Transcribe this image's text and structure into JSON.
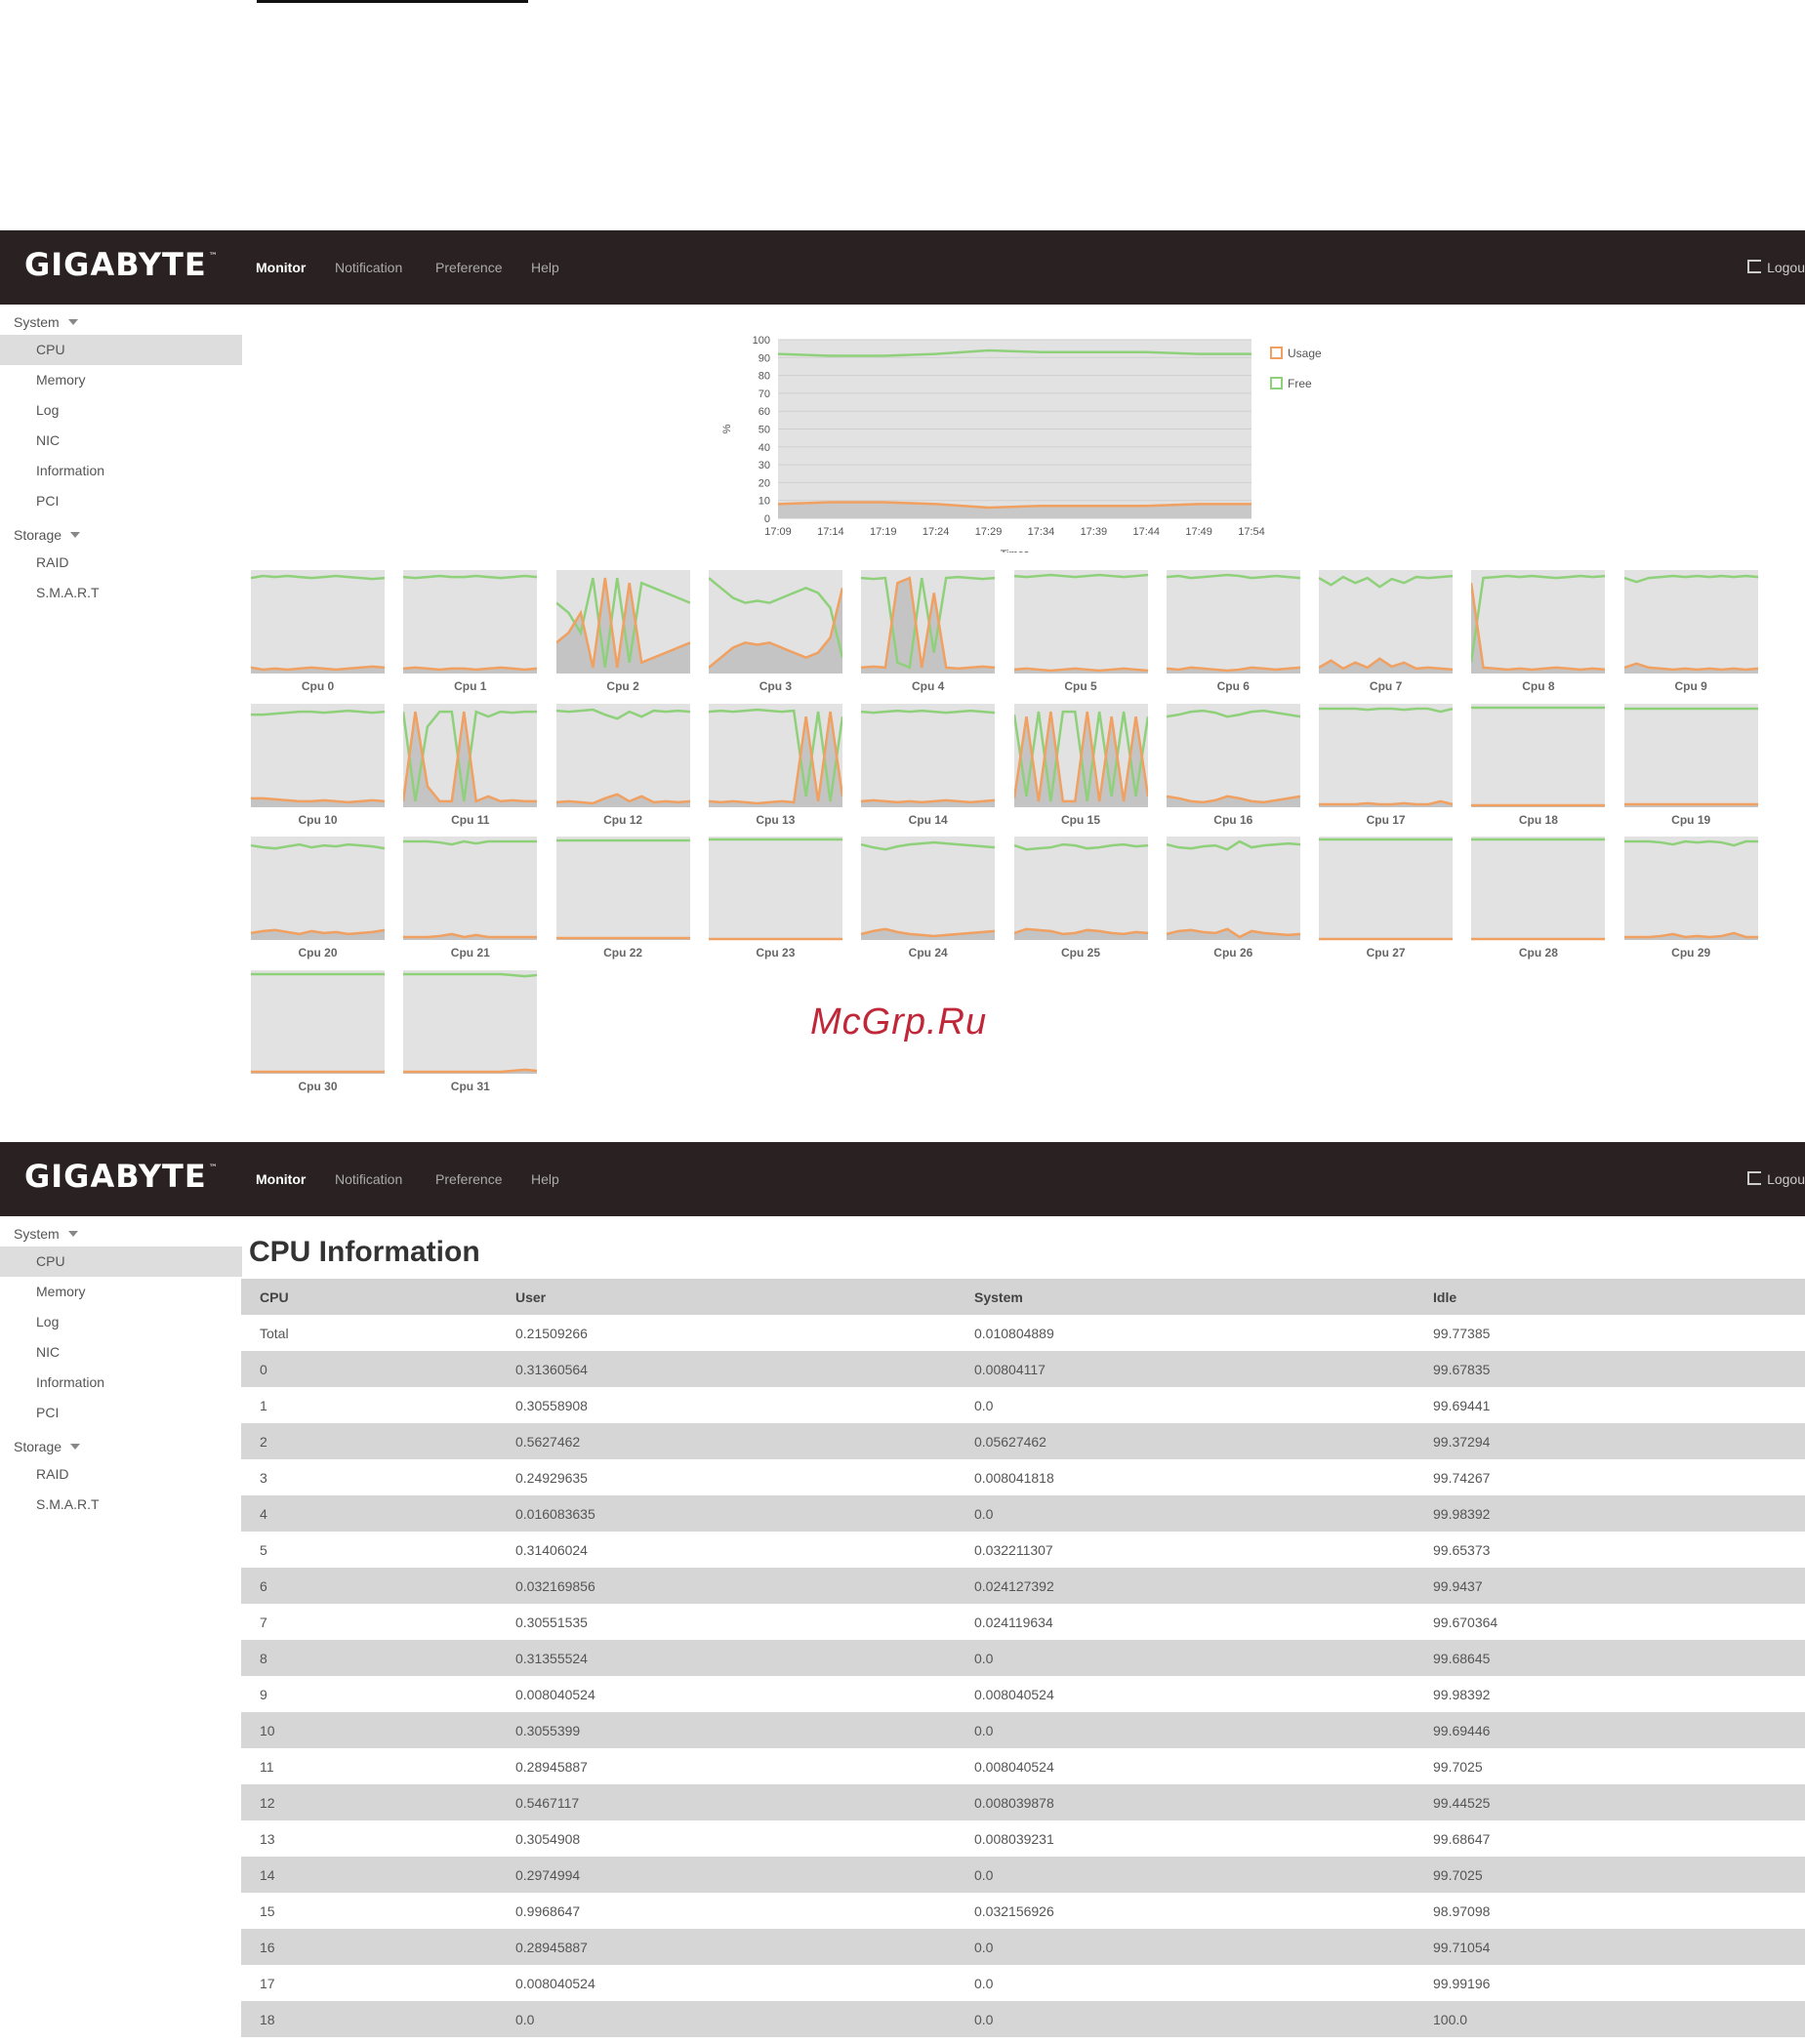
{
  "app": {
    "brand": "GIGABYTE",
    "brand_mark": "™",
    "nav": [
      "Monitor",
      "Notification",
      "Preference",
      "Help"
    ],
    "active_nav": "Monitor",
    "logout_label": "Logou"
  },
  "sidebar": {
    "groups": [
      {
        "label": "System",
        "items": [
          "CPU",
          "Memory",
          "Log",
          "NIC",
          "Information",
          "PCI"
        ]
      },
      {
        "label": "Storage",
        "items": [
          "RAID",
          "S.M.A.R.T"
        ]
      }
    ],
    "active_item": "CPU"
  },
  "watermark": "McGrp.Ru",
  "colors": {
    "usage": "#f0a060",
    "free": "#8fd07a",
    "fill": "#e2e2e2",
    "topbar": "#2a2222"
  },
  "chart_data": [
    {
      "type": "line",
      "title": "",
      "xlabel": "Times",
      "ylabel": "%",
      "ylim": [
        0,
        100
      ],
      "yticks": [
        0,
        10,
        20,
        30,
        40,
        50,
        60,
        70,
        80,
        90,
        100
      ],
      "x": [
        "17:09",
        "17:14",
        "17:19",
        "17:24",
        "17:29",
        "17:34",
        "17:39",
        "17:44",
        "17:49",
        "17:54"
      ],
      "legend_position": "right",
      "series": [
        {
          "name": "Usage",
          "values": [
            8,
            9,
            9,
            8,
            6,
            7,
            7,
            7,
            8,
            8
          ]
        },
        {
          "name": "Free",
          "values": [
            92,
            91,
            91,
            92,
            94,
            93,
            93,
            93,
            92,
            92
          ]
        }
      ]
    },
    {
      "type": "area",
      "ylim": [
        0,
        100
      ],
      "cpus": [
        {
          "label": "Cpu 0",
          "usage": [
            5,
            3,
            4,
            3,
            4,
            5,
            4,
            3,
            4,
            5,
            6,
            5
          ]
        },
        {
          "label": "Cpu 1",
          "usage": [
            4,
            5,
            4,
            3,
            4,
            4,
            3,
            4,
            5,
            4,
            3,
            4
          ]
        },
        {
          "label": "Cpu 2",
          "usage": [
            30,
            40,
            60,
            5,
            95,
            5,
            90,
            10,
            15,
            20,
            25,
            30
          ]
        },
        {
          "label": "Cpu 3",
          "usage": [
            5,
            15,
            25,
            30,
            28,
            30,
            25,
            20,
            15,
            20,
            35,
            85
          ]
        },
        {
          "label": "Cpu 4",
          "usage": [
            5,
            6,
            5,
            90,
            95,
            5,
            80,
            5,
            4,
            5,
            6,
            5
          ]
        },
        {
          "label": "Cpu 5",
          "usage": [
            3,
            4,
            3,
            2,
            3,
            4,
            3,
            2,
            3,
            4,
            3,
            2
          ]
        },
        {
          "label": "Cpu 6",
          "usage": [
            4,
            3,
            5,
            4,
            3,
            2,
            3,
            5,
            4,
            3,
            4,
            5
          ]
        },
        {
          "label": "Cpu 7",
          "usage": [
            5,
            12,
            4,
            10,
            5,
            14,
            6,
            10,
            4,
            5,
            4,
            3
          ]
        },
        {
          "label": "Cpu 8",
          "usage": [
            90,
            5,
            4,
            3,
            4,
            3,
            4,
            5,
            4,
            3,
            4,
            3
          ]
        },
        {
          "label": "Cpu 9",
          "usage": [
            5,
            9,
            5,
            4,
            3,
            4,
            3,
            4,
            3,
            4,
            3,
            4
          ]
        },
        {
          "label": "Cpu 10",
          "usage": [
            8,
            8,
            7,
            6,
            5,
            5,
            6,
            5,
            4,
            5,
            6,
            5
          ]
        },
        {
          "label": "Cpu 11",
          "usage": [
            5,
            95,
            20,
            5,
            5,
            95,
            5,
            10,
            5,
            6,
            5,
            5
          ]
        },
        {
          "label": "Cpu 12",
          "usage": [
            4,
            5,
            4,
            3,
            8,
            12,
            5,
            10,
            4,
            5,
            4,
            5
          ]
        },
        {
          "label": "Cpu 13",
          "usage": [
            5,
            4,
            5,
            4,
            3,
            4,
            5,
            4,
            90,
            5,
            95,
            10
          ]
        },
        {
          "label": "Cpu 14",
          "usage": [
            5,
            6,
            5,
            4,
            5,
            4,
            5,
            6,
            5,
            4,
            5,
            6
          ]
        },
        {
          "label": "Cpu 15",
          "usage": [
            8,
            90,
            5,
            95,
            5,
            5,
            95,
            5,
            90,
            5,
            90,
            10
          ]
        },
        {
          "label": "Cpu 16",
          "usage": [
            10,
            8,
            5,
            4,
            6,
            10,
            8,
            5,
            4,
            6,
            8,
            10
          ]
        },
        {
          "label": "Cpu 17",
          "usage": [
            2,
            2,
            2,
            2,
            3,
            2,
            2,
            3,
            2,
            2,
            5,
            2
          ]
        },
        {
          "label": "Cpu 18",
          "usage": [
            1,
            1,
            1,
            1,
            1,
            1,
            1,
            1,
            1,
            1,
            1,
            1
          ]
        },
        {
          "label": "Cpu 19",
          "usage": [
            2,
            2,
            2,
            2,
            2,
            2,
            2,
            2,
            2,
            2,
            2,
            2
          ]
        },
        {
          "label": "Cpu 20",
          "usage": [
            6,
            8,
            9,
            7,
            5,
            8,
            6,
            7,
            5,
            6,
            7,
            9
          ]
        },
        {
          "label": "Cpu 21",
          "usage": [
            2,
            2,
            2,
            3,
            5,
            2,
            4,
            2,
            2,
            2,
            2,
            2
          ]
        },
        {
          "label": "Cpu 22",
          "usage": [
            1,
            1,
            1,
            1,
            1,
            1,
            1,
            1,
            1,
            1,
            1,
            1
          ]
        },
        {
          "label": "Cpu 23",
          "usage": [
            0,
            0,
            0,
            0,
            0,
            0,
            0,
            0,
            0,
            0,
            0,
            0
          ]
        },
        {
          "label": "Cpu 24",
          "usage": [
            5,
            8,
            10,
            7,
            5,
            4,
            3,
            4,
            5,
            6,
            7,
            8
          ]
        },
        {
          "label": "Cpu 25",
          "usage": [
            6,
            10,
            9,
            8,
            5,
            6,
            9,
            8,
            6,
            5,
            7,
            6
          ]
        },
        {
          "label": "Cpu 26",
          "usage": [
            5,
            8,
            9,
            7,
            6,
            10,
            2,
            8,
            6,
            5,
            4,
            5
          ]
        },
        {
          "label": "Cpu 27",
          "usage": [
            0,
            0,
            0,
            0,
            0,
            0,
            0,
            0,
            0,
            0,
            0,
            0
          ]
        },
        {
          "label": "Cpu 28",
          "usage": [
            0,
            0,
            0,
            0,
            0,
            0,
            0,
            0,
            0,
            0,
            0,
            0
          ]
        },
        {
          "label": "Cpu 29",
          "usage": [
            2,
            2,
            2,
            3,
            5,
            2,
            3,
            2,
            3,
            6,
            2,
            2
          ]
        },
        {
          "label": "Cpu 30",
          "usage": [
            1,
            1,
            1,
            1,
            1,
            1,
            1,
            1,
            1,
            1,
            1,
            1
          ]
        },
        {
          "label": "Cpu 31",
          "usage": [
            1,
            1,
            1,
            1,
            1,
            1,
            1,
            1,
            1,
            2,
            3,
            2
          ]
        }
      ]
    }
  ],
  "cpu_info": {
    "title": "CPU Information",
    "columns": [
      "CPU",
      "User",
      "System",
      "Idle"
    ],
    "rows": [
      [
        "Total",
        "0.21509266",
        "0.010804889",
        "99.77385"
      ],
      [
        "0",
        "0.31360564",
        "0.00804117",
        "99.67835"
      ],
      [
        "1",
        "0.30558908",
        "0.0",
        "99.69441"
      ],
      [
        "2",
        "0.5627462",
        "0.05627462",
        "99.37294"
      ],
      [
        "3",
        "0.24929635",
        "0.008041818",
        "99.74267"
      ],
      [
        "4",
        "0.016083635",
        "0.0",
        "99.98392"
      ],
      [
        "5",
        "0.31406024",
        "0.032211307",
        "99.65373"
      ],
      [
        "6",
        "0.032169856",
        "0.024127392",
        "99.9437"
      ],
      [
        "7",
        "0.30551535",
        "0.024119634",
        "99.670364"
      ],
      [
        "8",
        "0.31355524",
        "0.0",
        "99.68645"
      ],
      [
        "9",
        "0.008040524",
        "0.008040524",
        "99.98392"
      ],
      [
        "10",
        "0.3055399",
        "0.0",
        "99.69446"
      ],
      [
        "11",
        "0.28945887",
        "0.008040524",
        "99.7025"
      ],
      [
        "12",
        "0.5467117",
        "0.008039878",
        "99.44525"
      ],
      [
        "13",
        "0.3054908",
        "0.008039231",
        "99.68647"
      ],
      [
        "14",
        "0.2974994",
        "0.0",
        "99.7025"
      ],
      [
        "15",
        "0.9968647",
        "0.032156926",
        "98.97098"
      ],
      [
        "16",
        "0.28945887",
        "0.0",
        "99.71054"
      ],
      [
        "17",
        "0.008040524",
        "0.0",
        "99.99196"
      ],
      [
        "18",
        "0.0",
        "0.0",
        "100.0"
      ]
    ]
  }
}
